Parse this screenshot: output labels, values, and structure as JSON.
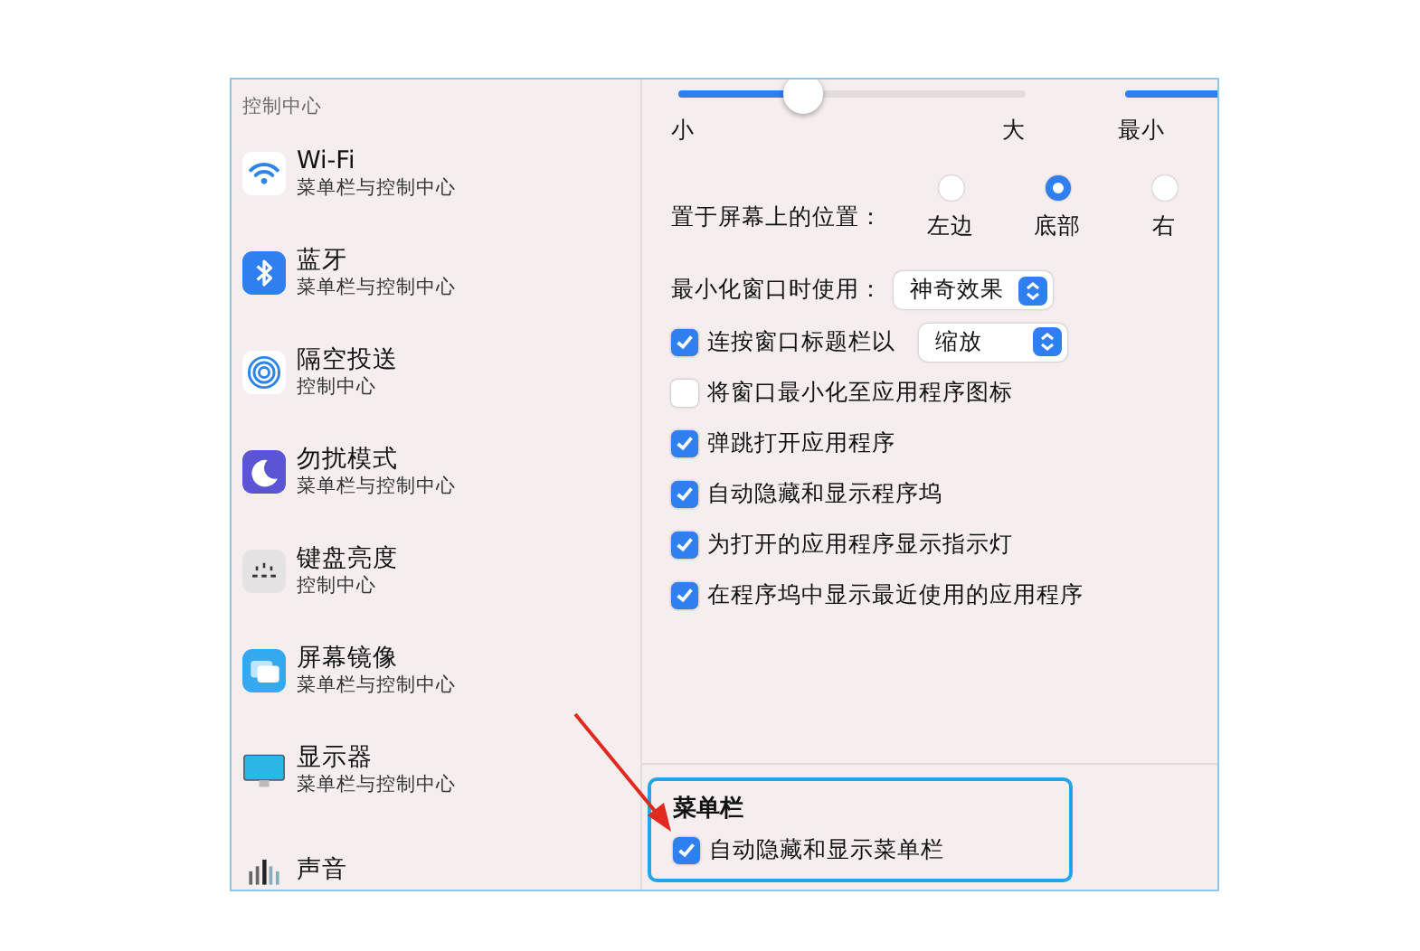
{
  "sidebar": {
    "header": "控制中心",
    "items": [
      {
        "title": "Wi-Fi",
        "subtitle": "菜单栏与控制中心"
      },
      {
        "title": "蓝牙",
        "subtitle": "菜单栏与控制中心"
      },
      {
        "title": "隔空投送",
        "subtitle": "控制中心"
      },
      {
        "title": "勿扰模式",
        "subtitle": "菜单栏与控制中心"
      },
      {
        "title": "键盘亮度",
        "subtitle": "控制中心"
      },
      {
        "title": "屏幕镜像",
        "subtitle": "菜单栏与控制中心"
      },
      {
        "title": "显示器",
        "subtitle": "菜单栏与控制中心"
      },
      {
        "title": "声音"
      }
    ]
  },
  "dock": {
    "sliders": [
      {
        "min_label": "小",
        "max_label": "大",
        "level": 0.36
      },
      {
        "min_label": "最小",
        "level": 1
      }
    ],
    "position": {
      "label": "置于屏幕上的位置：",
      "options": [
        {
          "label": "左边",
          "selected": false
        },
        {
          "label": "底部",
          "selected": true
        },
        {
          "label": "右",
          "selected": false
        }
      ]
    },
    "minimize_effect": {
      "label": "最小化窗口时使用：",
      "value": "神奇效果"
    },
    "options": [
      {
        "kind": "select",
        "label": "连按窗口标题栏以",
        "checked": true,
        "value": "缩放"
      },
      {
        "kind": "check",
        "label": "将窗口最小化至应用程序图标",
        "checked": false
      },
      {
        "kind": "check",
        "label": "弹跳打开应用程序",
        "checked": true
      },
      {
        "kind": "check",
        "label": "自动隐藏和显示程序坞",
        "checked": true
      },
      {
        "kind": "check",
        "label": "为打开的应用程序显示指示灯",
        "checked": true
      },
      {
        "kind": "check",
        "label": "在程序坞中显示最近使用的应用程序",
        "checked": true
      }
    ]
  },
  "menu_bar": {
    "title": "菜单栏",
    "options": [
      {
        "label": "自动隐藏和显示菜单栏",
        "checked": true
      }
    ]
  }
}
